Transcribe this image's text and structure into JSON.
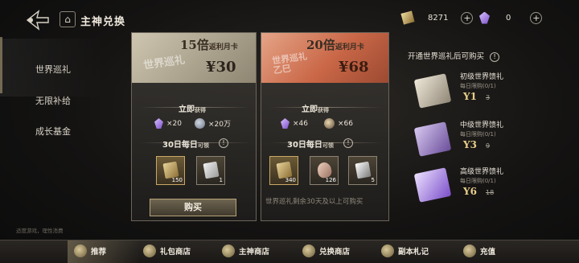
{
  "header": {
    "title": "主神兑换",
    "currency_gold": "8271",
    "currency_gem": "0",
    "plus": "+"
  },
  "sidebar": {
    "items": [
      {
        "label": "世界巡礼"
      },
      {
        "label": "无限补给"
      },
      {
        "label": "成长基金"
      }
    ]
  },
  "card1": {
    "multiplier": "15倍",
    "multiplier_suffix": "返利",
    "month_card": "月卡",
    "subtitle": "世界巡礼",
    "price": "¥30",
    "instant_label": "立即",
    "instant_suffix": "获得",
    "instant_rewards": [
      {
        "icon": "gem-icon",
        "amount": "×20"
      },
      {
        "icon": "coin-icon",
        "amount": "×20万"
      }
    ],
    "daily_label": "30日每日",
    "daily_suffix": "可领",
    "daily_rewards": [
      {
        "icon": "ticket-icon",
        "amount": "150"
      },
      {
        "icon": "card-icon",
        "amount": "1"
      }
    ],
    "buy_label": "购买"
  },
  "card2": {
    "multiplier": "20倍",
    "multiplier_suffix": "返利",
    "month_card": "月卡",
    "subtitle": "世界巡礼 乙巳",
    "price": "¥68",
    "instant_label": "立即",
    "instant_suffix": "获得",
    "instant_rewards": [
      {
        "icon": "gem-icon",
        "amount": "×46"
      },
      {
        "icon": "orb-icon",
        "amount": "×66"
      }
    ],
    "daily_label": "30日每日",
    "daily_suffix": "可领",
    "daily_rewards": [
      {
        "icon": "ticket-icon",
        "amount": "340"
      },
      {
        "icon": "heart-icon",
        "amount": "126"
      },
      {
        "icon": "crystal-icon",
        "amount": "5"
      }
    ],
    "notice": "世界巡礼剩余30天及以上可购买"
  },
  "right_panel": {
    "title": "开通世界巡礼后可购买",
    "gifts": [
      {
        "name": "初级世界馈礼",
        "limit": "每日限购(0/1)",
        "price": "Y1",
        "original": "3"
      },
      {
        "name": "中级世界馈礼",
        "limit": "每日限购(0/1)",
        "price": "Y3",
        "original": "9"
      },
      {
        "name": "高级世界馈礼",
        "limit": "每日限购(0/1)",
        "price": "Y6",
        "original": "18"
      }
    ]
  },
  "footer_note": "适度游戏，理性消费",
  "bottom_tabs": [
    {
      "label": "推荐"
    },
    {
      "label": "礼包商店"
    },
    {
      "label": "主神商店"
    },
    {
      "label": "兑换商店"
    },
    {
      "label": "副本札记"
    },
    {
      "label": "充值"
    }
  ],
  "colors": {
    "accent_gold": "#c9b68a",
    "price_gold": "#e8cf8a",
    "card2_head": "#d27a58"
  }
}
